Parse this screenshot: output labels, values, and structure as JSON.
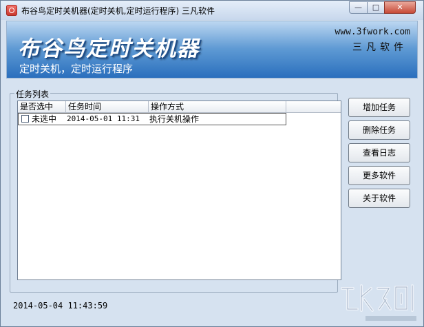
{
  "window": {
    "title": "布谷鸟定时关机器(定时关机,定时运行程序) 三凡软件",
    "min_glyph": "—",
    "max_glyph": "□",
    "close_glyph": "✕"
  },
  "banner": {
    "logo": "布谷鸟定时关机器",
    "subtitle": "定时关机，定时运行程序",
    "url": "www.3fwork.com",
    "brand": "三凡软件"
  },
  "tasks": {
    "group_title": "任务列表",
    "columns": [
      "是否选中",
      "任务时间",
      "操作方式"
    ],
    "rows": [
      {
        "selected": false,
        "selected_label": "未选中",
        "time": "2014-05-01 11:31",
        "action": "执行关机操作"
      }
    ]
  },
  "actions": {
    "add": "增加任务",
    "delete": "删除任务",
    "log": "查看日志",
    "more": "更多软件",
    "about": "关于软件"
  },
  "status": {
    "clock": "2014-05-04 11:43:59"
  },
  "colors": {
    "banner_top": "#bcd7f1",
    "banner_bottom": "#2a6fbd",
    "window_bg": "#d6e2f0"
  }
}
